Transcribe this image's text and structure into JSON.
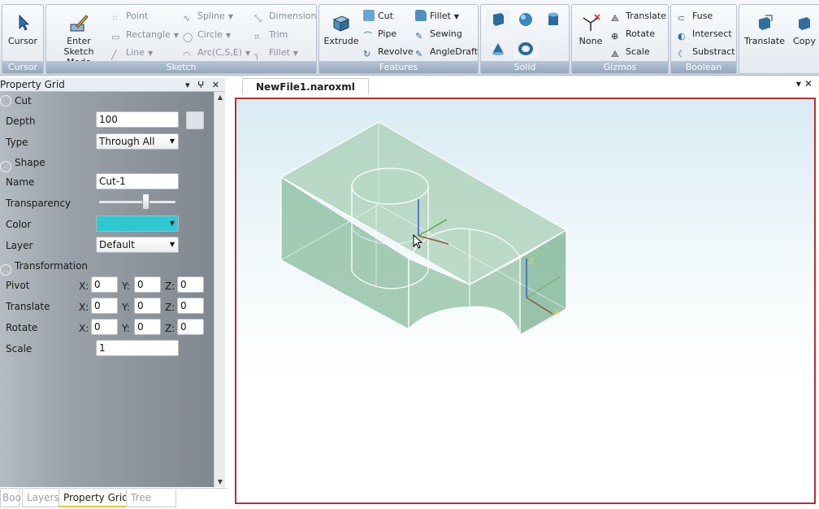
{
  "ribbon": {
    "cursor": {
      "label": "Cursor",
      "group": "Cursor"
    },
    "sketch": {
      "group": "Sketch",
      "enter": "Enter Sketch Mode",
      "point": "Point",
      "rectangle": "Rectangle",
      "line": "Line",
      "spline": "Spline",
      "circle": "Circle",
      "arc": "Arc(C,S,E)",
      "dimension": "Dimension",
      "trim": "Trim",
      "fillet": "Fillet"
    },
    "features": {
      "group": "Features",
      "extrude": "Extrude",
      "cut": "Cut",
      "pipe": "Pipe",
      "revolve": "Revolve",
      "fillet": "Fillet",
      "sewing": "Sewing",
      "angledraft": "AngleDraft"
    },
    "solid": {
      "group": "Solid"
    },
    "gizmos": {
      "group": "Gizmos",
      "none": "None",
      "translate": "Translate",
      "rotate": "Rotate",
      "scale": "Scale"
    },
    "boolean": {
      "group": "Boolean",
      "fuse": "Fuse",
      "intersect": "Intersect",
      "substract": "Substract"
    },
    "extra": {
      "translate": "Translate",
      "copy": "Copy"
    }
  },
  "property_grid": {
    "title": "Property Grid",
    "cut_category": "Cut",
    "depth_label": "Depth",
    "depth_value": "100",
    "type_label": "Type",
    "type_value": "Through All",
    "shape_category": "Shape",
    "name_label": "Name",
    "name_value": "Cut-1",
    "transparency_label": "Transparency",
    "transparency_level": 0.62,
    "color_label": "Color",
    "color_value": "#2ec8d3",
    "layer_label": "Layer",
    "layer_value": "Default",
    "transformation_category": "Transformation",
    "pivot_label": "Pivot",
    "translate_label": "Translate",
    "rotate_label": "Rotate",
    "scale_label": "Scale",
    "x": "X:",
    "y": "Y:",
    "z": "Z:",
    "pivot": [
      "0",
      "0",
      "0"
    ],
    "translate": [
      "0",
      "0",
      "0"
    ],
    "rotate": [
      "0",
      "0",
      "0"
    ],
    "scale_value": "1"
  },
  "bottom_tabs": [
    "Boo",
    "Layers",
    "Property Grid",
    "Tree View"
  ],
  "document": {
    "tab": "NewFile1.naroxml"
  },
  "colors": {
    "accent": "#b3303a",
    "part": "#8fbfa3"
  }
}
